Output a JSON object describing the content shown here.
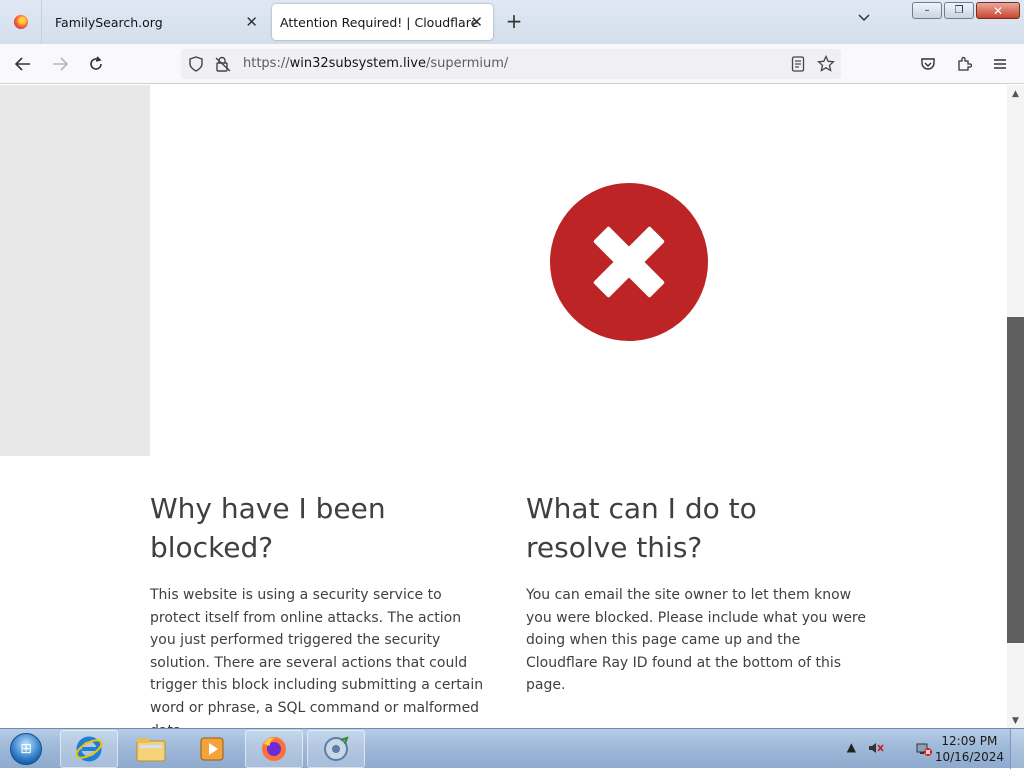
{
  "browser": {
    "tabs": [
      {
        "label": "FamilySearch.org",
        "close": "✕"
      },
      {
        "label": "Attention Required! | Cloudflare",
        "close": "✕"
      }
    ],
    "new_tab": "+",
    "tab_list": "⌄",
    "window_controls": {
      "minimize": "–",
      "restore": "❐",
      "close": "✕"
    },
    "nav": {
      "back": "←",
      "forward": "→",
      "reload": "↻"
    },
    "url": {
      "scheme": "https://",
      "host": "win32subsystem.live",
      "path": "/supermium/"
    },
    "toolbar_icons": [
      "reader-view-icon",
      "bookmark-star-icon",
      "pocket-icon",
      "extensions-icon",
      "menu-icon"
    ]
  },
  "page": {
    "left_heading": "Why have I been blocked?",
    "left_body": "This website is using a security service to protect itself from online attacks. The action you just performed triggered the security solution. There are several actions that could trigger this block including submitting a certain word or phrase, a SQL command or malformed data.",
    "right_heading": "What can I do to resolve this?",
    "right_body": "You can email the site owner to let them know you were blocked. Please include what you were doing when this page came up and the Cloudflare Ray ID found at the bottom of this page.",
    "error_color": "#bd2426"
  },
  "taskbar": {
    "start_icon": "windows-orb-icon",
    "apps": [
      "internet-explorer-icon",
      "file-explorer-icon",
      "media-player-icon",
      "firefox-icon",
      "app-icon"
    ],
    "clock": {
      "time": "12:09 PM",
      "date": "10/16/2024"
    },
    "tray_expand": "▲"
  }
}
